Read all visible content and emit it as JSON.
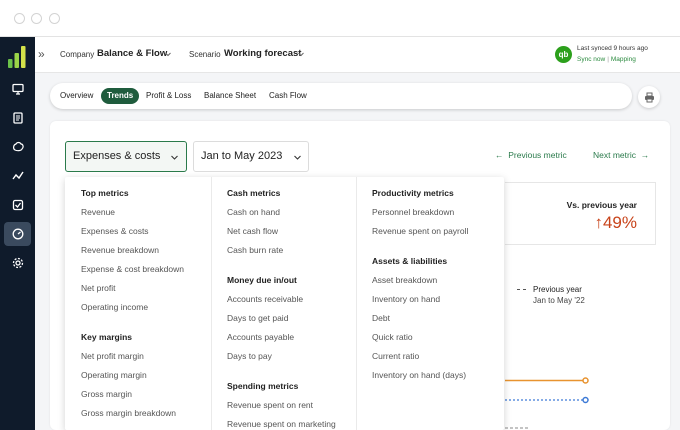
{
  "topbar": {
    "company_label": "Company",
    "company_value": "Balance & Flow",
    "scenario_label": "Scenario",
    "scenario_value": "Working forecast",
    "sync_status": "Last synced 9 hours ago",
    "sync_now": "Sync now",
    "mapping": "Mapping",
    "qb_logo": "qb"
  },
  "tabs": [
    "Overview",
    "Trends",
    "Profit & Loss",
    "Balance Sheet",
    "Cash Flow"
  ],
  "active_tab": "Trends",
  "controls": {
    "metric": "Expenses & costs",
    "date_range": "Jan to May 2023",
    "previous_metric": "Previous metric",
    "next_metric": "Next metric"
  },
  "stat": {
    "label": "Vs. previous year",
    "value": "49%",
    "direction": "up",
    "color": "#c8431a"
  },
  "legend": {
    "title": "Previous year",
    "subtitle": "Jan to May '22"
  },
  "chart_colors": {
    "current": "#e8932f",
    "previous": "#3d7ad6"
  },
  "menu": {
    "col1": {
      "sections": [
        {
          "heading": "Top metrics",
          "items": [
            "Revenue",
            "Expenses & costs",
            "Revenue breakdown",
            "Expense & cost breakdown",
            "Net profit",
            "Operating income"
          ]
        },
        {
          "heading": "Key margins",
          "items": [
            "Net profit margin",
            "Operating margin",
            "Gross margin",
            "Gross margin breakdown"
          ]
        }
      ]
    },
    "col2": {
      "sections": [
        {
          "heading": "Cash metrics",
          "items": [
            "Cash on hand",
            "Net cash flow",
            "Cash burn rate"
          ]
        },
        {
          "heading": "Money due in/out",
          "items": [
            "Accounts receivable",
            "Days to get paid",
            "Accounts payable",
            "Days to pay"
          ]
        },
        {
          "heading": "Spending metrics",
          "items": [
            "Revenue spent on rent",
            "Revenue spent on marketing"
          ]
        }
      ]
    },
    "col3": {
      "sections": [
        {
          "heading": "Productivity metrics",
          "items": [
            "Personnel breakdown",
            "Revenue spent on payroll"
          ]
        },
        {
          "heading": "Assets & liabilities",
          "items": [
            "Asset breakdown",
            "Inventory on hand",
            "Debt",
            "Quick ratio",
            "Current ratio",
            "Inventory on hand (days)"
          ]
        }
      ]
    }
  }
}
